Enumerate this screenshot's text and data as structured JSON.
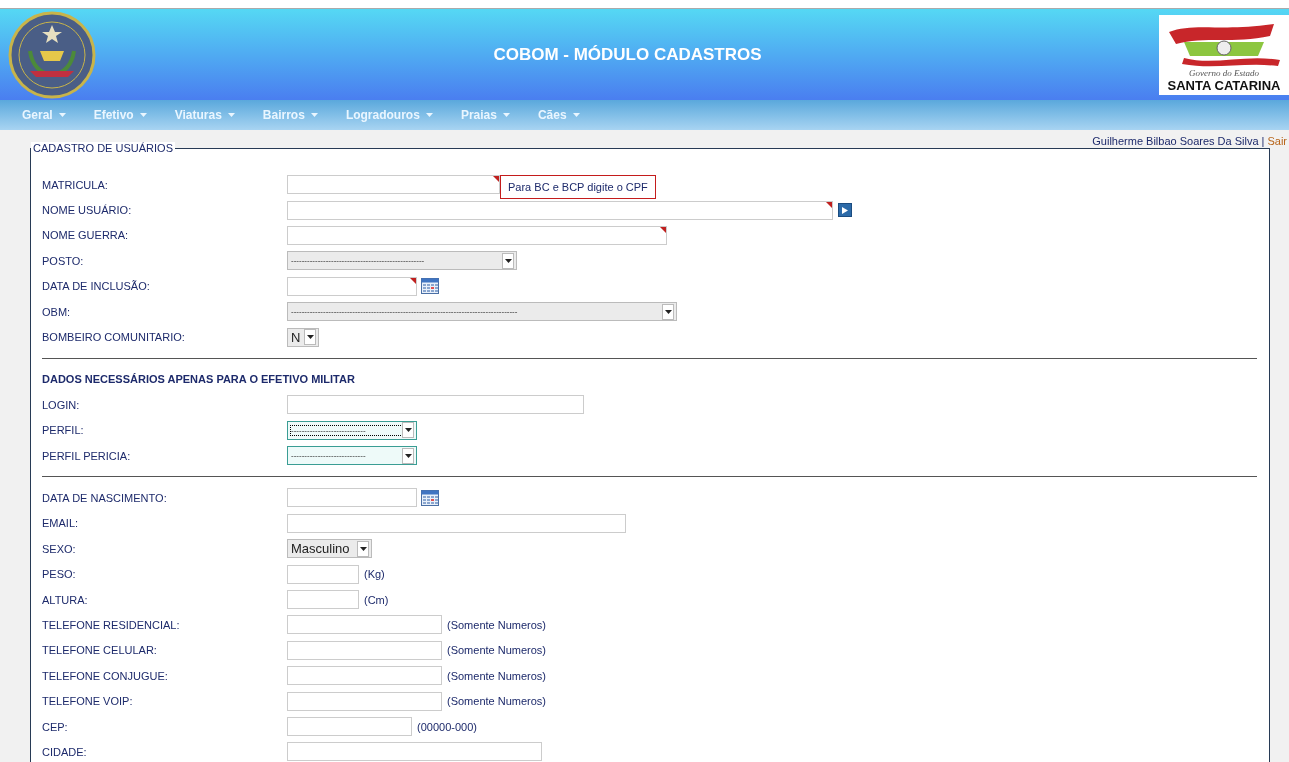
{
  "header": {
    "title": "COBOM - MÓDULO CADASTROS",
    "state_logo": {
      "line_1": "Governo do Estado",
      "line_2": "SANTA CATARINA"
    }
  },
  "nav": [
    {
      "label": "Geral"
    },
    {
      "label": "Efetivo"
    },
    {
      "label": "Viaturas"
    },
    {
      "label": "Bairros"
    },
    {
      "label": "Logradouros"
    },
    {
      "label": "Praias"
    },
    {
      "label": "Cães"
    }
  ],
  "user_bar": {
    "user": "Guilherme Bilbao Soares Da Silva",
    "separator": "|",
    "logout": "Sair"
  },
  "form": {
    "legend": "CADASTRO DE USUÁRIOS",
    "rows": [
      {
        "kind": "text",
        "label": "MATRICULA:",
        "required": true,
        "tooltip": "Para BC e BCP digite o CPF"
      },
      {
        "kind": "text",
        "label": "NOME USUÁRIO:",
        "required": true,
        "action_button": true
      },
      {
        "kind": "text",
        "label": "NOME GUERRA:",
        "required": true
      },
      {
        "kind": "select",
        "label": "POSTO:",
        "value": "--------------------------------------------------",
        "focused": false,
        "highlighted": false
      },
      {
        "kind": "date",
        "label": "DATA DE INCLUSÃO:",
        "required": true
      },
      {
        "kind": "select",
        "label": "OBM:",
        "value": "-------------------------------------------------------------------------------------",
        "focused": false,
        "highlighted": false
      },
      {
        "kind": "select",
        "label": "BOMBEIRO COMUNITARIO:",
        "value": "N",
        "focused": false,
        "highlighted": false
      },
      {
        "kind": "divider"
      },
      {
        "kind": "heading",
        "label": "DADOS NECESSÁRIOS APENAS PARA O EFETIVO MILITAR"
      },
      {
        "kind": "text",
        "label": "LOGIN:",
        "required": false
      },
      {
        "kind": "select",
        "label": "PERFIL:",
        "value": "----------------------------",
        "focused": true,
        "highlighted": true
      },
      {
        "kind": "select",
        "label": "PERFIL PERICIA:",
        "value": "----------------------------",
        "focused": false,
        "highlighted": true
      },
      {
        "kind": "divider"
      },
      {
        "kind": "date",
        "label": "DATA DE NASCIMENTO:",
        "required": false
      },
      {
        "kind": "text",
        "label": "EMAIL:",
        "required": false
      },
      {
        "kind": "select",
        "label": "SEXO:",
        "value": "Masculino",
        "focused": false,
        "highlighted": false
      },
      {
        "kind": "text",
        "label": "PESO:",
        "required": false,
        "suffix": "(Kg)"
      },
      {
        "kind": "text",
        "label": "ALTURA:",
        "required": false,
        "suffix": "(Cm)"
      },
      {
        "kind": "text",
        "label": "TELEFONE RESIDENCIAL:",
        "required": false,
        "suffix": "(Somente Numeros)"
      },
      {
        "kind": "text",
        "label": "TELEFONE CELULAR:",
        "required": false,
        "suffix": "(Somente Numeros)"
      },
      {
        "kind": "text",
        "label": "TELEFONE CONJUGUE:",
        "required": false,
        "suffix": "(Somente Numeros)"
      },
      {
        "kind": "text",
        "label": "TELEFONE VOIP:",
        "required": false,
        "suffix": "(Somente Numeros)"
      },
      {
        "kind": "text",
        "label": "CEP:",
        "required": false,
        "suffix": "(00000-000)"
      },
      {
        "kind": "text",
        "label": "CIDADE:",
        "required": false
      }
    ]
  }
}
